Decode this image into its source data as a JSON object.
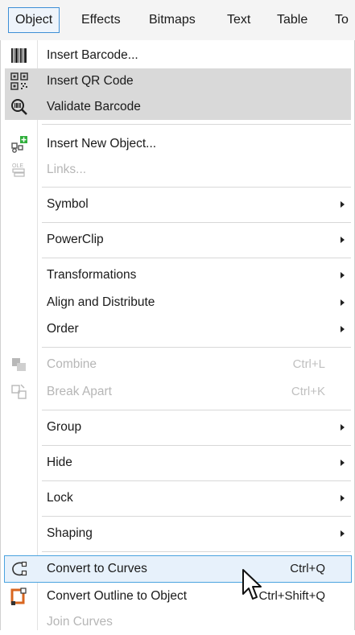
{
  "menubar": {
    "items": [
      {
        "label": "Object"
      },
      {
        "label": "Effects"
      },
      {
        "label": "Bitmaps"
      },
      {
        "label": "Text"
      },
      {
        "label": "Table"
      },
      {
        "label": "To"
      }
    ]
  },
  "menu": {
    "items": [
      {
        "label": "Insert Barcode...",
        "icon": "barcode-icon"
      },
      {
        "label": "Insert QR Code",
        "icon": "qr-code-icon"
      },
      {
        "label": "Validate Barcode",
        "icon": "validate-barcode-icon"
      },
      {
        "label": "Insert New Object...",
        "icon": "insert-object-icon"
      },
      {
        "label": "Links...",
        "icon": "ole-links-icon"
      },
      {
        "label": "Symbol"
      },
      {
        "label": "PowerClip"
      },
      {
        "label": "Transformations"
      },
      {
        "label": "Align and Distribute"
      },
      {
        "label": "Order"
      },
      {
        "label": "Combine",
        "shortcut": "Ctrl+L",
        "icon": "combine-icon"
      },
      {
        "label": "Break Apart",
        "shortcut": "Ctrl+K",
        "icon": "break-apart-icon"
      },
      {
        "label": "Group"
      },
      {
        "label": "Hide"
      },
      {
        "label": "Lock"
      },
      {
        "label": "Shaping"
      },
      {
        "label": "Convert to Curves",
        "shortcut": "Ctrl+Q",
        "icon": "convert-to-curves-icon"
      },
      {
        "label": "Convert Outline to Object",
        "shortcut": "Ctrl+Shift+Q",
        "icon": "convert-outline-icon"
      },
      {
        "label": "Join Curves"
      }
    ]
  },
  "colors": {
    "highlight_border": "#4aa3df",
    "highlight_fill": "#e7f1fb",
    "hover_gray": "#d9d9d9",
    "disabled_text": "#b6b6b6",
    "accent_green": "#2fae3b",
    "accent_orange": "#d9661f"
  }
}
